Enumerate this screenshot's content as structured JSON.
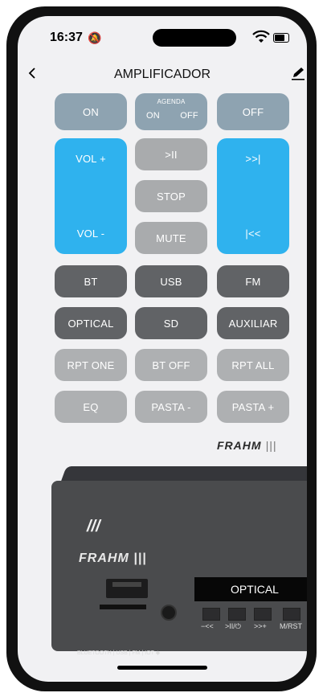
{
  "status": {
    "time": "16:37"
  },
  "header": {
    "title": "AMPLIFICADOR"
  },
  "buttons": {
    "on": "ON",
    "agenda_label": "AGENDA",
    "agenda_on": "ON",
    "agenda_off": "OFF",
    "off": "OFF",
    "vol_plus": "VOL +",
    "vol_minus": "VOL -",
    "play_pause": ">II",
    "stop": "STOP",
    "mute": "MUTE",
    "next": ">>|",
    "prev": "|<<",
    "bt": "BT",
    "usb": "USB",
    "fm": "FM",
    "optical": "OPTICAL",
    "sd": "SD",
    "auxiliar": "AUXILIAR",
    "rpt_one": "RPT ONE",
    "bt_off": "BT OFF",
    "rpt_all": "RPT ALL",
    "eq": "EQ",
    "pasta_minus": "PASTA -",
    "pasta_plus": "PASTA +"
  },
  "brand": {
    "name": "FRAHM"
  },
  "device": {
    "display_text": "OPTICAL",
    "brand": "FRAHM",
    "controls": [
      "−<<",
      ">II/⏻",
      ">>+",
      "M/RST"
    ],
    "footer": "BLUETOOTH | USB | FM | IOT"
  },
  "colors": {
    "slate": "#8ea3b1",
    "blue": "#2fb2ee",
    "light_gray": "#a9abad",
    "dark_gray": "#616366"
  },
  "icons": {
    "back": "chevron-left-icon",
    "edit": "pencil-icon",
    "silent": "bell-slash-icon",
    "wifi": "wifi-icon",
    "battery": "battery-icon"
  }
}
